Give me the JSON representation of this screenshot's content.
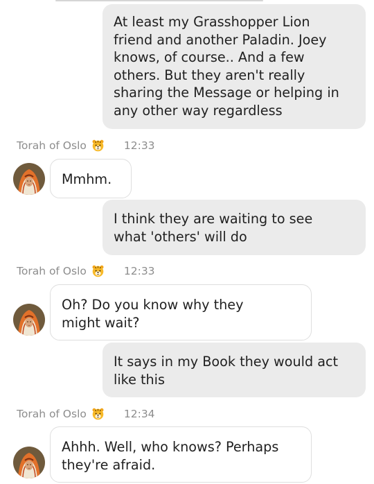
{
  "messages": [
    {
      "from": "me",
      "text": "At least my Grasshopper Lion\nfriend and another Paladin. Joey\nknows, of course.. And a few\nothers. But they aren't really\nsharing the Message or helping in\nany other way regardless"
    },
    {
      "from": "them",
      "sender": "Torah of Oslo",
      "time": "12:33",
      "text": "Mmhm."
    },
    {
      "from": "me",
      "text": "I think they are waiting to see\nwhat 'others' will do"
    },
    {
      "from": "them",
      "sender": "Torah of Oslo",
      "time": "12:33",
      "text": "Oh? Do you know why they\nmight wait?"
    },
    {
      "from": "me",
      "text": "It says in my Book they would act\nlike this"
    },
    {
      "from": "them",
      "sender": "Torah of Oslo",
      "time": "12:34",
      "text": "Ahhh. Well, who knows? Perhaps\nthey're afraid."
    }
  ],
  "sender_emoji": "tiger-face-icon",
  "colors": {
    "my_bubble": "#ebebeb",
    "their_bubble": "#ffffff",
    "meta_text": "#8d8d8d",
    "message_text": "#1f1f1f"
  }
}
